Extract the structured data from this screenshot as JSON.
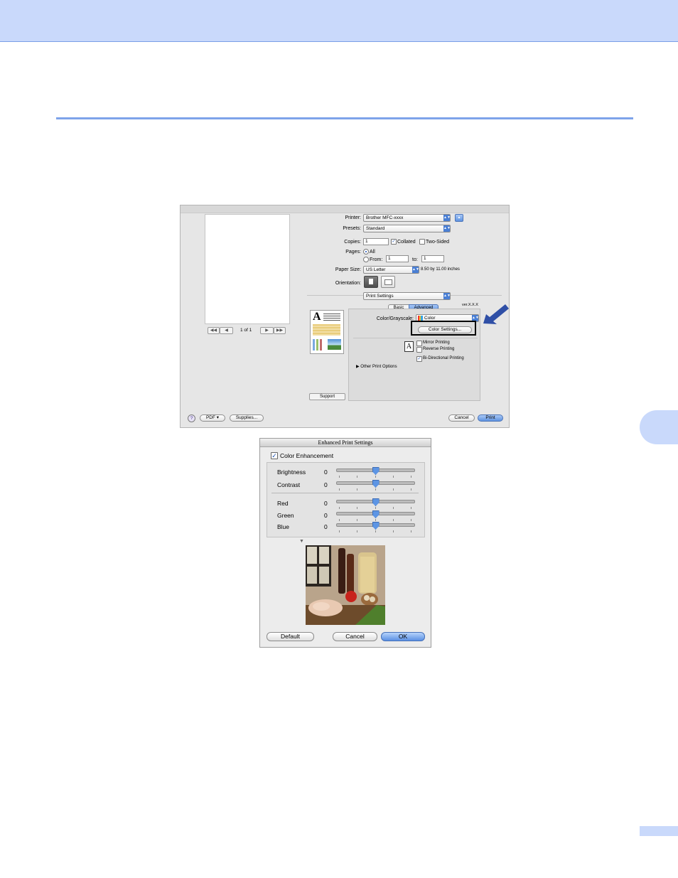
{
  "print_dialog": {
    "page_nav": {
      "first": "◀◀",
      "prev": "◀",
      "page_of": "1 of 1",
      "next": "▶",
      "last": "▶▶"
    },
    "printer": {
      "label": "Printer:",
      "value": "Brother MFC-xxxx"
    },
    "presets": {
      "label": "Presets:",
      "value": "Standard"
    },
    "copies": {
      "label": "Copies:",
      "value": "1",
      "collated": "Collated",
      "two_sided": "Two-Sided"
    },
    "pages": {
      "label": "Pages:",
      "all": "All",
      "from": "From:",
      "from_value": "1",
      "to": "to:",
      "to_value": "1"
    },
    "paper_size": {
      "label": "Paper Size:",
      "value": "US Letter",
      "dimensions": "8.50 by 11.00 inches"
    },
    "orientation": {
      "label": "Orientation:"
    },
    "section_popup": "Print Settings",
    "tabs": {
      "basic": "Basic",
      "advanced": "Advanced"
    },
    "version": "ver.X.X.X",
    "color_grayscale": {
      "label": "Color/Grayscale:",
      "value": "Color"
    },
    "color_settings_button": "Color Settings...",
    "mirror_printing": "Mirror Printing",
    "reverse_printing": "Reverse Printing",
    "bi_directional": "Bi-Directional Printing",
    "other_print_options": "Other Print Options",
    "support_button": "Support",
    "help": "?",
    "pdf_button": "PDF ▾",
    "supplies_button": "Supplies...",
    "cancel_button": "Cancel",
    "print_button": "Print"
  },
  "enhanced_dialog": {
    "title": "Enhanced Print Settings",
    "color_enhancement": "Color Enhancement",
    "sliders": [
      {
        "label": "Brightness",
        "value": "0",
        "level": 0.5
      },
      {
        "label": "Contrast",
        "value": "0",
        "level": 0.5
      },
      {
        "label": "Red",
        "value": "0",
        "level": 0.5
      },
      {
        "label": "Green",
        "value": "0",
        "level": 0.5
      },
      {
        "label": "Blue",
        "value": "0",
        "level": 0.5
      }
    ],
    "default_button": "Default",
    "cancel_button": "Cancel",
    "ok_button": "OK"
  },
  "colors": {
    "header_band": "#c9d9fb",
    "accent_rule": "#7ea3ea",
    "arrow": "#2f4fa6",
    "aqua_button": "#5f93e0"
  }
}
